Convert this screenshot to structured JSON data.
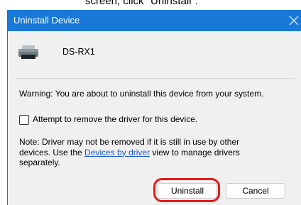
{
  "caption": "screen, click \"Uninstall\".",
  "dialog": {
    "title": "Uninstall Device",
    "device_name": "DS-RX1",
    "warning": "Warning: You are about to uninstall this device from your system.",
    "checkbox_label": "Attempt to remove the driver for this device.",
    "checkbox_checked": false,
    "note_line1": "Note: Driver may not be removed if it is still in use by other",
    "note_line2_pre": "devices. Use the ",
    "note_link": "Devices by driver",
    "note_line2_post": " view to manage drivers",
    "note_line3": "separately.",
    "uninstall_label": "Uninstall",
    "cancel_label": "Cancel"
  },
  "colors": {
    "titlebar": "#1979d8",
    "link": "#1a58c4",
    "highlight": "#e21a1a"
  },
  "icons": {
    "close": "close-icon",
    "device": "printer-icon"
  }
}
